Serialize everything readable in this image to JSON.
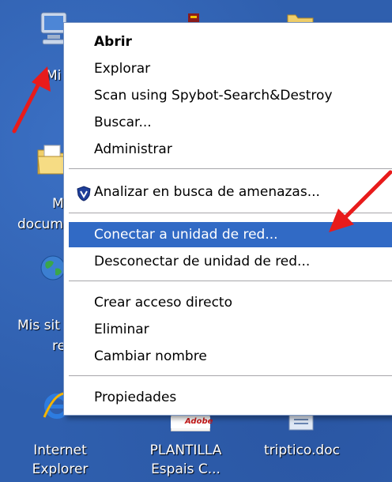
{
  "desktop": {
    "icons": [
      {
        "label_line1": "Mi"
      },
      {
        "label_line1": "M",
        "label_line2": "docum"
      },
      {
        "label_line1": "Mis sit",
        "label_line2": "re"
      },
      {
        "label_line1": "Internet",
        "label_line2": "Explorer"
      },
      {
        "label_line1": "PLANTILLA",
        "label_line2": "Espais C..."
      },
      {
        "label_line1": "triptico.doc"
      }
    ],
    "adobe_badge": "Adobe"
  },
  "context_menu": {
    "items": [
      {
        "label": "Abrir"
      },
      {
        "label": "Explorar"
      },
      {
        "label": "Scan using Spybot-Search&Destroy"
      },
      {
        "label": "Buscar..."
      },
      {
        "label": "Administrar"
      },
      {
        "label": "Analizar en busca de amenazas..."
      },
      {
        "label": "Conectar a unidad de red..."
      },
      {
        "label": "Desconectar de unidad de red..."
      },
      {
        "label": "Crear acceso directo"
      },
      {
        "label": "Eliminar"
      },
      {
        "label": "Cambiar nombre"
      },
      {
        "label": "Propiedades"
      }
    ],
    "selected_item": "Conectar a unidad de red...",
    "colors": {
      "highlight": "#316ac5",
      "annotation_arrow": "#e81b1b"
    }
  }
}
